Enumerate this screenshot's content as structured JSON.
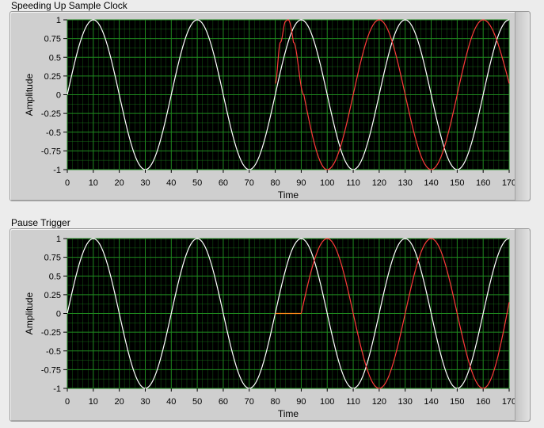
{
  "colors": {
    "plot_bg": "#000000",
    "grid": "#1f8a1f",
    "series_white": "#ffffff",
    "series_red": "#ff3a3a",
    "series_orange": "#ff8c1a"
  },
  "chart_data": [
    {
      "type": "line",
      "title": "Speeding Up Sample Clock",
      "xlabel": "Time",
      "ylabel": "Amplitude",
      "xlim": [
        0,
        170
      ],
      "ylim": [
        -1,
        1
      ],
      "xticks": [
        "0",
        "10",
        "20",
        "30",
        "40",
        "50",
        "60",
        "70",
        "80",
        "90",
        "100",
        "110",
        "120",
        "130",
        "140",
        "150",
        "160",
        "170"
      ],
      "yticks": [
        "1",
        "0.75",
        "0.5",
        "0.25",
        "0",
        "-0.25",
        "-0.5",
        "-0.75",
        "-1"
      ],
      "grid": true,
      "series": [
        {
          "color": "white",
          "x": [
            0,
            10,
            20,
            30,
            40,
            50,
            60,
            70,
            80,
            90,
            100,
            110,
            120,
            130,
            140,
            150,
            160,
            170
          ],
          "y": [
            0,
            1,
            0,
            -1,
            0,
            1,
            0,
            -1,
            0,
            1,
            0,
            -1,
            0,
            1,
            0,
            -1,
            0,
            1
          ]
        },
        {
          "color": "red",
          "x": [
            80,
            82,
            84,
            85,
            87,
            91,
            100,
            110,
            120,
            130,
            140,
            150,
            160,
            170
          ],
          "y": [
            0.15,
            0.7,
            0.98,
            1,
            0.7,
            0,
            -1,
            0,
            1,
            0,
            -1,
            0,
            1,
            0.15
          ]
        }
      ]
    },
    {
      "type": "line",
      "title": "Pause Trigger",
      "xlabel": "Time",
      "ylabel": "Amplitude",
      "xlim": [
        0,
        170
      ],
      "ylim": [
        -1,
        1
      ],
      "xticks": [
        "0",
        "10",
        "20",
        "30",
        "40",
        "50",
        "60",
        "70",
        "80",
        "90",
        "100",
        "110",
        "120",
        "130",
        "140",
        "150",
        "160",
        "170"
      ],
      "yticks": [
        "1",
        "0.75",
        "0.5",
        "0.25",
        "0",
        "-0.25",
        "-0.5",
        "-0.75",
        "-1"
      ],
      "grid": true,
      "series": [
        {
          "color": "white",
          "x": [
            0,
            10,
            20,
            30,
            40,
            50,
            60,
            70,
            80,
            90,
            100,
            110,
            120,
            130,
            140,
            150,
            160,
            170
          ],
          "y": [
            0,
            1,
            0,
            -1,
            0,
            1,
            0,
            -1,
            0,
            1,
            0,
            -1,
            0,
            1,
            0,
            -1,
            0,
            1
          ]
        },
        {
          "color": "orange",
          "x": [
            80,
            90
          ],
          "y": [
            0,
            0
          ]
        },
        {
          "color": "red",
          "x": [
            90,
            100,
            110,
            120,
            130,
            140,
            150,
            160,
            170
          ],
          "y": [
            0,
            1,
            0,
            -1,
            0,
            1,
            0,
            -1,
            0.15
          ]
        }
      ]
    }
  ]
}
